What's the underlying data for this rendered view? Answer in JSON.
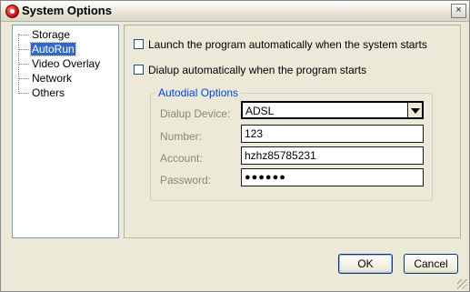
{
  "window": {
    "title": "System Options",
    "close_glyph": "×"
  },
  "tree": {
    "items": [
      {
        "label": "Storage"
      },
      {
        "label": "AutoRun"
      },
      {
        "label": "Video Overlay"
      },
      {
        "label": "Network"
      },
      {
        "label": "Others"
      }
    ],
    "selected": "AutoRun"
  },
  "autorun": {
    "launch_label": "Launch the program automatically when the system starts",
    "launch_checked": false,
    "dialup_label": "Dialup automatically when the program starts",
    "dialup_checked": false
  },
  "autodial": {
    "group_title": "Autodial Options",
    "dialup_device_label": "Dialup Device:",
    "dialup_device_value": "ADSL",
    "number_label": "Number:",
    "number_value": "123",
    "account_label": "Account:",
    "account_value": "hzhz85785231",
    "password_label": "Password:",
    "password_value": "●●●●●●"
  },
  "buttons": {
    "ok": "OK",
    "cancel": "Cancel"
  }
}
